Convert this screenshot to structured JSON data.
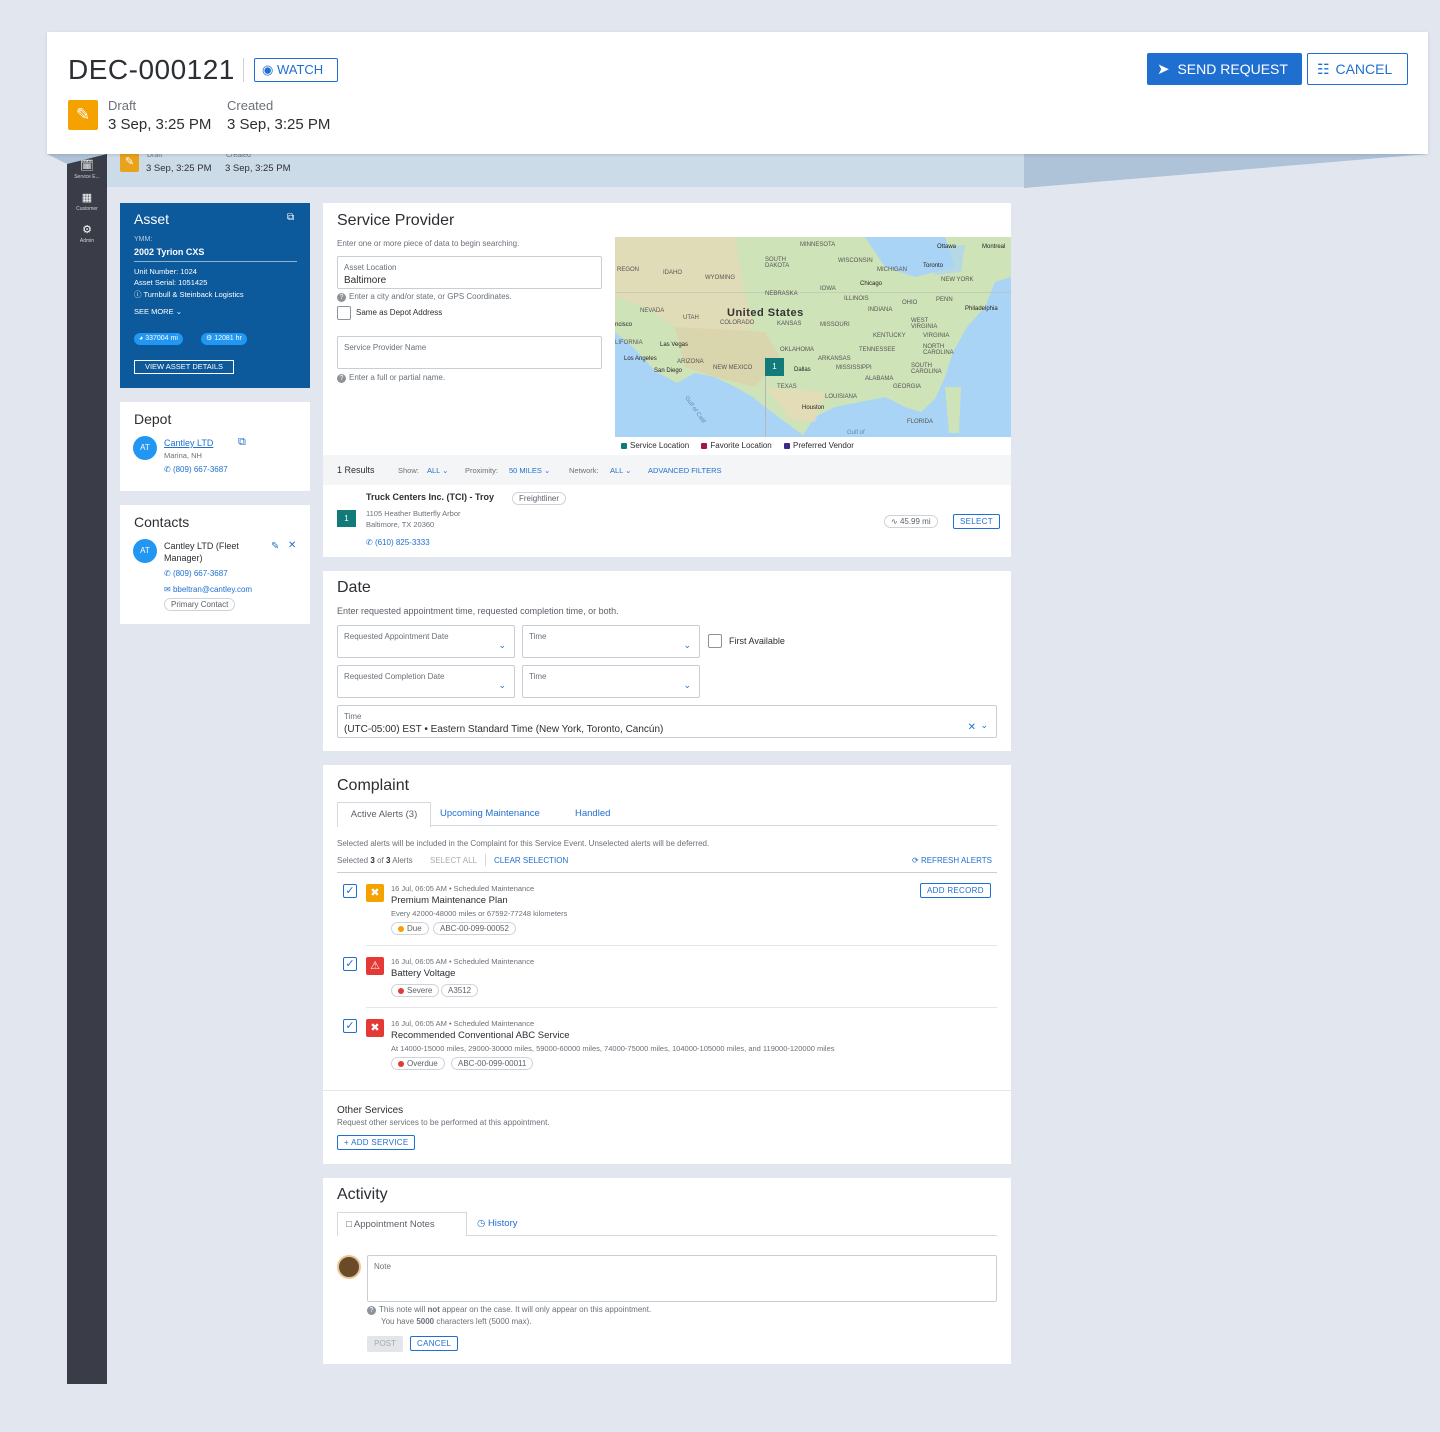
{
  "header": {
    "case_id": "DEC-000121",
    "watch_label": "WATCH",
    "status_label": "Draft",
    "status_date": "3 Sep, 3:25 PM",
    "created_label": "Created",
    "created_date": "3 Sep, 3:25 PM",
    "send_label": "SEND REQUEST",
    "cancel_label": "CANCEL"
  },
  "strip": {
    "status_label": "Draft",
    "status_date": "3 Sep, 3:25 PM",
    "created_label": "Created",
    "created_date": "3 Sep, 3:25 PM"
  },
  "sidebar": {
    "items": [
      {
        "label": "Service E...",
        "icon": "calendar-icon"
      },
      {
        "label": "Customer",
        "icon": "building-icon"
      },
      {
        "label": "Admin",
        "icon": "gear-icon"
      }
    ]
  },
  "asset": {
    "title": "Asset",
    "ymm_label": "YMM:",
    "ymm_value": "2002 Tyrion CXS",
    "unit_number": "Unit Number: 1024",
    "asset_serial": "Asset Serial: 1051425",
    "owner": "Turnbull & Steinback Logistics",
    "see_more": "SEE MORE",
    "mileage": "337004 mi",
    "hours": "12081 hr",
    "details_button": "VIEW ASSET DETAILS"
  },
  "depot": {
    "title": "Depot",
    "initials": "AT",
    "name": "Cantley LTD",
    "location": "Marina, NH",
    "phone": "(809) 667-3687"
  },
  "contacts": {
    "title": "Contacts",
    "initials": "AT",
    "name": "Cantley LTD (Fleet Manager)",
    "phone": "(809) 667-3687",
    "email": "bbeltran@cantley.com",
    "badge": "Primary Contact"
  },
  "service_provider": {
    "title": "Service Provider",
    "intro": "Enter one or more piece of data to begin searching.",
    "location_label": "Asset Location",
    "location_value": "Baltimore",
    "location_help": "Enter a city and/or state, or GPS Coordinates.",
    "same_as_depot": "Same as Depot Address",
    "name_label": "Service Provider Name",
    "name_help": "Enter a full or partial name.",
    "results_count": "1 Results",
    "show_label": "Show:",
    "show_value": "ALL",
    "proximity_label": "Proximity:",
    "proximity_value": "50 MILES",
    "network_label": "Network:",
    "network_value": "ALL",
    "advanced_filters": "ADVANCED FILTERS",
    "map": {
      "country": "United States",
      "pin": "1",
      "legend": [
        "Service Location",
        "Favorite Location",
        "Preferred Vendor"
      ],
      "legend_colors": [
        "#127a78",
        "#a0174f",
        "#3b2a8c"
      ],
      "labels": [
        "MINNESOTA",
        "Ottawa",
        "Montreal",
        "SOUTH DAKOTA",
        "WISCONSIN",
        "MICHIGAN",
        "Toronto",
        "REGON",
        "IDAHO",
        "WYOMING",
        "IOWA",
        "Chicago",
        "NEW YORK",
        "NEBRASKA",
        "ILLINOIS",
        "OHIO",
        "PENN",
        "Philadelphia",
        "NEVADA",
        "UTAH",
        "COLORADO",
        "KANSAS",
        "MISSOURI",
        "INDIANA",
        "ncisco",
        "WEST VIRGINIA",
        "KENTUCKY",
        "VIRGINIA",
        "LIFORNIA",
        "Las Vegas",
        "OKLAHOMA",
        "TENNESSEE",
        "NORTH CAROLINA",
        "Los Angeles",
        "ARIZONA",
        "ARKANSAS",
        "San Diego",
        "NEW MEXICO",
        "Dallas",
        "MISSISSIPPI",
        "SOUTH CAROLINA",
        "ALABAMA",
        "GEORGIA",
        "TEXAS",
        "LOUISIANA",
        "Houston",
        "FLORIDA",
        "Gulf of Calif",
        "Gulf of"
      ]
    },
    "result": {
      "pin": "1",
      "name": "Truck Centers Inc. (TCI) - Troy",
      "brand": "Freightliner",
      "street": "1105 Heather Butterfly Arbor",
      "city": "Baltimore, TX 20360",
      "phone": "(610) 825-3333",
      "distance": "45.99 mi",
      "select": "SELECT"
    }
  },
  "date": {
    "title": "Date",
    "intro": "Enter requested appointment time, requested completion time, or both.",
    "appt_label": "Requested Appointment Date",
    "time_label": "Time",
    "first_available": "First Available",
    "completion_label": "Requested Completion Date",
    "time2_label": "Time",
    "tz_label": "Time",
    "tz_value": "(UTC-05:00) EST • Eastern Standard Time (New York, Toronto, Cancún)"
  },
  "complaint": {
    "title": "Complaint",
    "tabs": [
      "Active Alerts (3)",
      "Upcoming Maintenance",
      "Handled"
    ],
    "info": "Selected alerts will be included in the Complaint for this Service Event. Unselected alerts will be deferred.",
    "selected_prefix": "Selected",
    "selected_count": "3",
    "selected_of": "of",
    "selected_total": "3",
    "selected_suffix": "Alerts",
    "select_all": "SELECT ALL",
    "clear_selection": "CLEAR SELECTION",
    "refresh": "REFRESH ALERTS",
    "add_record": "ADD RECORD",
    "alerts": [
      {
        "meta": "16 Jul, 06:05 AM • Scheduled Maintenance",
        "title": "Premium Maintenance Plan",
        "desc": "Every 42000-48000 miles or 67592-77248 kilometers",
        "status": "Due",
        "code": "ABC-00-099-00052",
        "color": "#f5a100",
        "dot": "#f5a100",
        "icon": "tools-icon"
      },
      {
        "meta": "16 Jul, 06:05 AM • Scheduled Maintenance",
        "title": "Battery Voltage",
        "desc": "",
        "status": "Severe",
        "code": "A3512",
        "color": "#e53935",
        "dot": "#e53935",
        "icon": "warning-icon"
      },
      {
        "meta": "16 Jul, 06:05 AM • Scheduled Maintenance",
        "title": "Recommended Conventional ABC Service",
        "desc": "At 14000-15000 miles, 29000-30000 miles, 59000-60000 miles, 74000-75000 miles, 104000-105000 miles, and 119000-120000 miles",
        "status": "Overdue",
        "code": "ABC-00-099-00011",
        "color": "#e53935",
        "dot": "#e53935",
        "icon": "tools-icon"
      }
    ],
    "other_title": "Other Services",
    "other_desc": "Request other services to be performed at this appointment.",
    "add_service": "ADD SERVICE"
  },
  "activity": {
    "title": "Activity",
    "tabs": [
      "Appointment Notes",
      "History"
    ],
    "note_label": "Note",
    "help_pre": "This note will",
    "help_bold": "not",
    "help_post": "appear on the case. It will only appear on this appointment.",
    "chars_pre": "You have",
    "chars_bold": "5000",
    "chars_post": "characters left (5000 max).",
    "post": "POST",
    "cancel": "CANCEL"
  }
}
